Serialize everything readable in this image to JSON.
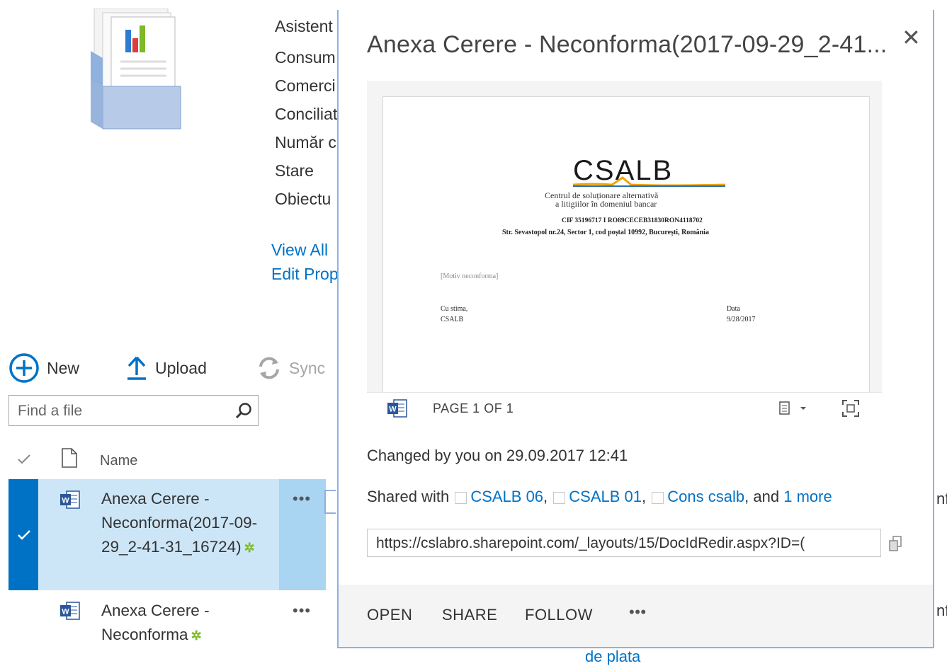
{
  "properties": {
    "labels": [
      "Asistent",
      "Consum",
      "Comerci",
      "Conciliat",
      "Număr c",
      "Stare",
      "Obiectu"
    ],
    "view_all": "View All",
    "edit_props": "Edit Prop"
  },
  "toolbar": {
    "new_label": "New",
    "upload_label": "Upload",
    "sync_label": "Sync"
  },
  "search": {
    "placeholder": "Find a file"
  },
  "list": {
    "header_name": "Name",
    "rows": [
      {
        "title": "Anexa Cerere - Neconforma(2017-09-29_2-41-31_16724)",
        "selected": true
      },
      {
        "title": "Anexa Cerere - Neconforma",
        "selected": false
      }
    ],
    "below_text": "de plata"
  },
  "callout": {
    "title": "Anexa Cerere - Neconforma(2017-09-29_2-41...",
    "close_icon": "close-icon",
    "document": {
      "logo_text": "CSALB",
      "subtitle_1": "Centrul de soluționare alternativă",
      "subtitle_2": "a litigiilor în domeniul bancar",
      "cif_line": "CIF 35196717 I RO89CECEB31830RON4118702",
      "address_line": "Str. Sevastopol nr.24, Sector 1, cod poștal 10992, București, România",
      "motiv": "[Motiv neconforma]",
      "greeting_1": "Cu stima,",
      "greeting_2": "CSALB",
      "date_label": "Data",
      "date_value": "9/28/2017"
    },
    "page_indicator": "PAGE 1 OF 1",
    "changed_text": "Changed by you on 29.09.2017 12:41",
    "shared": {
      "prefix": "Shared with",
      "users": [
        "CSALB 06",
        "CSALB 01",
        "Cons csalb"
      ],
      "separator": ",",
      "and_text": "and",
      "more_text": "1 more"
    },
    "url": "https://cslabro.sharepoint.com/_layouts/15/DocIdRedir.aspx?ID=(",
    "actions": [
      "OPEN",
      "SHARE",
      "FOLLOW"
    ],
    "more_actions": "•••"
  },
  "colors": {
    "accent": "#0072c6",
    "selected_row": "#cde6f7",
    "selected_check_bar": "#0072c6",
    "new_badge": "#7db928"
  }
}
